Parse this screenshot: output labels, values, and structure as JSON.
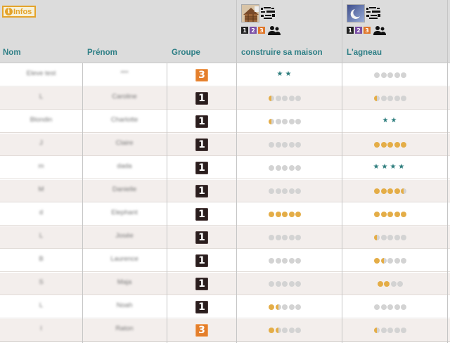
{
  "infos_button": {
    "label": "Infos",
    "icon": "info-icon"
  },
  "activities": [
    {
      "thumbnail": "house-construction-image",
      "levels": [
        "1",
        "2",
        "3"
      ]
    },
    {
      "thumbnail": "moon-night-image",
      "levels": [
        "1",
        "2",
        "3"
      ]
    }
  ],
  "columns": {
    "nom": "Nom",
    "prenom": "Prénom",
    "groupe": "Groupe",
    "act1": "construire sa maison",
    "act2": "L'agneau"
  },
  "colors": {
    "accent": "#2e7f86",
    "info": "#e4a32a",
    "progress": "#e4ad47",
    "star": "#2d7d7d",
    "group1": "#2a1e1e",
    "group3": "#e47f2c"
  },
  "students": [
    {
      "nom": "Eleve test",
      "prenom": "***",
      "groupe": "3",
      "act1": {
        "type": "stars",
        "value": 2
      },
      "act2": {
        "type": "dots",
        "value": 0
      }
    },
    {
      "nom": "L",
      "prenom": "Caroline",
      "groupe": "1",
      "act1": {
        "type": "dots",
        "value": 0.5
      },
      "act2": {
        "type": "dots",
        "value": 0.5
      }
    },
    {
      "nom": "Blondin",
      "prenom": "Charlotte",
      "groupe": "1",
      "act1": {
        "type": "dots",
        "value": 0.5
      },
      "act2": {
        "type": "stars",
        "value": 2
      }
    },
    {
      "nom": "J",
      "prenom": "Claire",
      "groupe": "1",
      "act1": {
        "type": "dots",
        "value": 0
      },
      "act2": {
        "type": "dots",
        "value": 5
      }
    },
    {
      "nom": "m",
      "prenom": "dada",
      "groupe": "1",
      "act1": {
        "type": "dots",
        "value": 0
      },
      "act2": {
        "type": "stars",
        "value": 4
      }
    },
    {
      "nom": "M",
      "prenom": "Danielle",
      "groupe": "1",
      "act1": {
        "type": "dots",
        "value": 0
      },
      "act2": {
        "type": "dots",
        "value": 4.5
      }
    },
    {
      "nom": "d",
      "prenom": "Elephant",
      "groupe": "1",
      "act1": {
        "type": "dots",
        "value": 5
      },
      "act2": {
        "type": "dots",
        "value": 5
      }
    },
    {
      "nom": "L",
      "prenom": "Josée",
      "groupe": "1",
      "act1": {
        "type": "dots",
        "value": 0
      },
      "act2": {
        "type": "dots",
        "value": 0.5
      }
    },
    {
      "nom": "B",
      "prenom": "Laurence",
      "groupe": "1",
      "act1": {
        "type": "dots",
        "value": 0
      },
      "act2": {
        "type": "dots",
        "value": 1.5
      }
    },
    {
      "nom": "S",
      "prenom": "Maja",
      "groupe": "1",
      "act1": {
        "type": "dots",
        "value": 0
      },
      "act2": {
        "type": "dots4",
        "value": 2
      }
    },
    {
      "nom": "L",
      "prenom": "Noah",
      "groupe": "1",
      "act1": {
        "type": "dots",
        "value": 1.5
      },
      "act2": {
        "type": "dots",
        "value": 0
      }
    },
    {
      "nom": "l",
      "prenom": "Raton",
      "groupe": "3",
      "act1": {
        "type": "dots",
        "value": 1.5
      },
      "act2": {
        "type": "dots",
        "value": 0.5
      }
    }
  ]
}
